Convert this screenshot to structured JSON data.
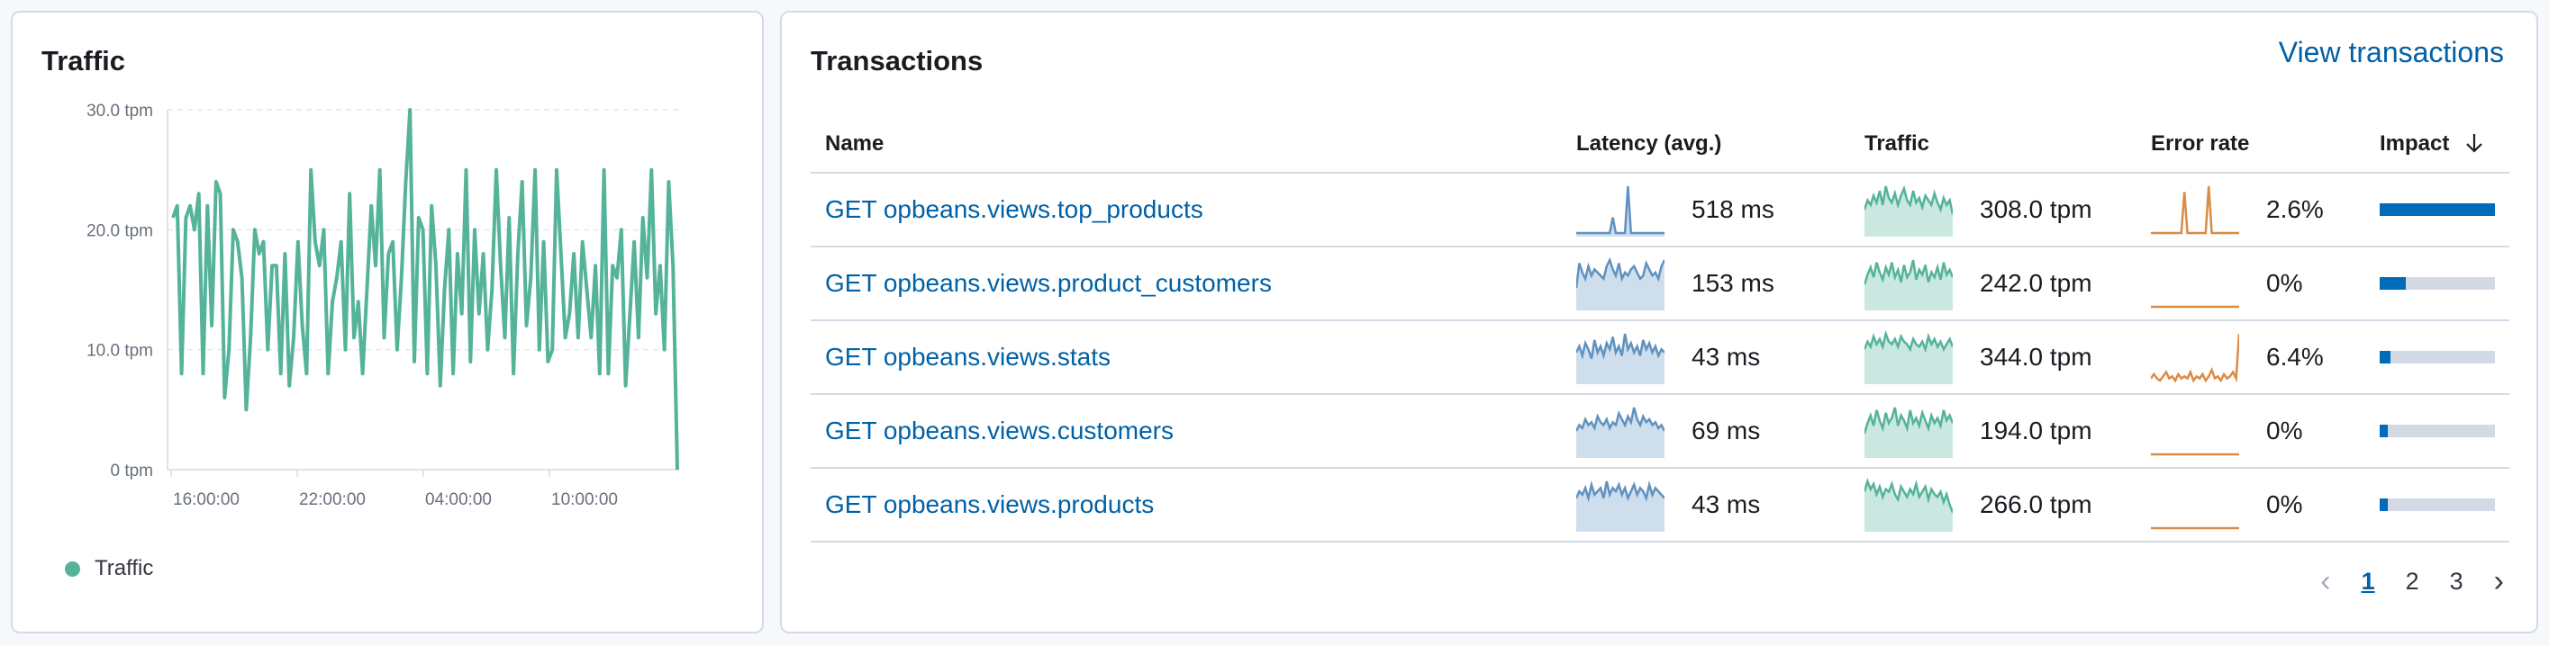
{
  "traffic_panel": {
    "title": "Traffic",
    "legend_label": "Traffic",
    "series_color": "#54b399"
  },
  "chart_data": {
    "type": "line",
    "y_ticks": [
      "30.0 tpm",
      "20.0 tpm",
      "10.0 tpm",
      "0 tpm"
    ],
    "y_tick_values": [
      30,
      20,
      10,
      0
    ],
    "ylim": [
      0,
      30
    ],
    "x_ticks": [
      "16:00:00",
      "22:00:00",
      "04:00:00",
      "10:00:00"
    ],
    "series": [
      {
        "name": "Traffic",
        "values": [
          21,
          22,
          8,
          21,
          22,
          20,
          23,
          8,
          22,
          12,
          24,
          23,
          6,
          10,
          20,
          19,
          16,
          5,
          11,
          20,
          18,
          19,
          10,
          17,
          17,
          8,
          18,
          7,
          11,
          19,
          12,
          8,
          25,
          19,
          17,
          20,
          8,
          14,
          16,
          19,
          10,
          23,
          11,
          14,
          8,
          15,
          22,
          17,
          25,
          11,
          18,
          19,
          10,
          16,
          24,
          30,
          9,
          21,
          20,
          8,
          22,
          17,
          7,
          15,
          20,
          8,
          18,
          13,
          25,
          9,
          20,
          13,
          18,
          10,
          15,
          25,
          17,
          11,
          21,
          8,
          18,
          24,
          12,
          16,
          25,
          10,
          19,
          9,
          10,
          25,
          18,
          11,
          13,
          18,
          11,
          19,
          15,
          11,
          17,
          8,
          25,
          8,
          17,
          16,
          20,
          7,
          13,
          19,
          11,
          21,
          16,
          25,
          13,
          17,
          10,
          24,
          17,
          0
        ]
      }
    ],
    "grid": true
  },
  "transactions_panel": {
    "title": "Transactions",
    "view_link": "View transactions",
    "columns": {
      "name": "Name",
      "latency": "Latency (avg.)",
      "traffic": "Traffic",
      "error_rate": "Error rate",
      "impact": "Impact",
      "impact_sort_icon": "arrow-down-icon"
    },
    "colors": {
      "latency": "#6092c0",
      "traffic": "#54b399",
      "error": "#da8b45",
      "impact": "#006bb8"
    },
    "rows": [
      {
        "name": "GET opbeans.views.top_products",
        "latency": "518 ms",
        "traffic": "308.0 tpm",
        "error_rate": "2.6%",
        "impact": 1.0,
        "latency_spark": [
          0,
          0,
          0,
          0,
          0,
          0,
          0,
          0,
          0,
          0,
          0,
          0,
          8,
          0,
          0,
          0,
          0,
          24,
          0,
          0,
          0,
          0,
          0,
          0,
          0,
          0,
          0,
          0,
          0,
          0
        ],
        "traffic_spark": [
          10,
          14,
          12,
          16,
          13,
          18,
          12,
          20,
          15,
          13,
          17,
          12,
          16,
          19,
          14,
          12,
          18,
          13,
          15,
          11,
          16,
          14,
          12,
          17,
          13,
          10,
          15,
          12,
          14,
          8
        ],
        "error_spark": [
          0,
          0,
          0,
          0,
          0,
          0,
          0,
          0,
          0,
          0,
          0,
          14,
          0,
          0,
          0,
          0,
          0,
          0,
          0,
          16,
          0,
          0,
          0,
          0,
          0,
          0,
          0,
          0,
          0,
          0
        ]
      },
      {
        "name": "GET opbeans.views.product_customers",
        "latency": "153 ms",
        "traffic": "242.0 tpm",
        "error_rate": "0%",
        "impact": 0.23,
        "latency_spark": [
          6,
          14,
          11,
          9,
          13,
          10,
          12,
          11,
          10,
          9,
          13,
          15,
          12,
          10,
          14,
          9,
          11,
          10,
          12,
          13,
          11,
          9,
          10,
          14,
          12,
          10,
          11,
          9,
          13,
          15
        ],
        "traffic_spark": [
          9,
          13,
          16,
          12,
          18,
          14,
          11,
          16,
          13,
          18,
          12,
          15,
          10,
          17,
          12,
          14,
          19,
          11,
          15,
          13,
          17,
          10,
          14,
          12,
          16,
          11,
          18,
          13,
          15,
          12
        ],
        "error_spark": [
          0,
          0,
          0,
          0,
          0,
          0,
          0,
          0,
          0,
          0,
          0,
          0,
          0,
          0,
          0,
          0,
          0,
          0,
          0,
          0,
          0,
          0,
          0,
          0,
          0,
          0,
          0,
          0,
          0,
          0
        ]
      },
      {
        "name": "GET opbeans.views.stats",
        "latency": "43 ms",
        "traffic": "344.0 tpm",
        "error_rate": "6.4%",
        "impact": 0.09,
        "latency_spark": [
          9,
          11,
          8,
          12,
          10,
          7,
          13,
          9,
          11,
          8,
          12,
          10,
          14,
          9,
          11,
          8,
          15,
          10,
          12,
          9,
          11,
          8,
          13,
          10,
          12,
          9,
          11,
          8,
          10,
          9
        ],
        "traffic_spark": [
          12,
          15,
          13,
          17,
          14,
          16,
          13,
          18,
          15,
          14,
          16,
          13,
          17,
          15,
          14,
          12,
          16,
          14,
          13,
          15,
          12,
          17,
          14,
          16,
          13,
          15,
          12,
          14,
          16,
          13
        ],
        "error_spark": [
          1,
          3,
          1,
          0,
          2,
          4,
          1,
          2,
          0,
          3,
          1,
          2,
          1,
          4,
          0,
          2,
          1,
          3,
          0,
          2,
          5,
          1,
          2,
          0,
          3,
          1,
          2,
          4,
          1,
          22
        ]
      },
      {
        "name": "GET opbeans.views.customers",
        "latency": "69 ms",
        "traffic": "194.0 tpm",
        "error_rate": "0%",
        "impact": 0.07,
        "latency_spark": [
          8,
          10,
          9,
          12,
          10,
          11,
          9,
          13,
          11,
          10,
          12,
          9,
          11,
          10,
          14,
          12,
          10,
          13,
          11,
          16,
          12,
          10,
          13,
          11,
          12,
          10,
          11,
          9,
          10,
          8
        ],
        "traffic_spark": [
          8,
          12,
          15,
          11,
          17,
          13,
          10,
          16,
          12,
          14,
          18,
          11,
          15,
          13,
          10,
          17,
          12,
          14,
          11,
          16,
          13,
          10,
          15,
          12,
          14,
          11,
          17,
          13,
          15,
          12
        ],
        "error_spark": [
          0,
          0,
          0,
          0,
          0,
          0,
          0,
          0,
          0,
          0,
          0,
          0,
          0,
          0,
          0,
          0,
          0,
          0,
          0,
          0,
          0,
          0,
          0,
          0,
          0,
          0,
          0,
          0,
          0,
          0
        ]
      },
      {
        "name": "GET opbeans.views.products",
        "latency": "43 ms",
        "traffic": "266.0 tpm",
        "error_rate": "0%",
        "impact": 0.07,
        "latency_spark": [
          9,
          11,
          10,
          12,
          9,
          13,
          10,
          11,
          12,
          9,
          14,
          10,
          12,
          11,
          13,
          10,
          12,
          9,
          11,
          13,
          10,
          12,
          11,
          9,
          13,
          10,
          12,
          11,
          10,
          9
        ],
        "traffic_spark": [
          14,
          18,
          15,
          17,
          13,
          16,
          12,
          15,
          14,
          17,
          13,
          11,
          16,
          14,
          12,
          15,
          13,
          17,
          12,
          14,
          16,
          11,
          15,
          13,
          12,
          14,
          10,
          13,
          9,
          6
        ],
        "error_spark": [
          0,
          0,
          0,
          0,
          0,
          0,
          0,
          0,
          0,
          0,
          0,
          0,
          0,
          0,
          0,
          0,
          0,
          0,
          0,
          0,
          0,
          0,
          0,
          0,
          0,
          0,
          0,
          0,
          0,
          0
        ]
      }
    ],
    "pagination": {
      "pages": [
        "1",
        "2",
        "3"
      ],
      "current": "1",
      "prev_icon": "chevron-left-icon",
      "next_icon": "chevron-right-icon"
    }
  }
}
